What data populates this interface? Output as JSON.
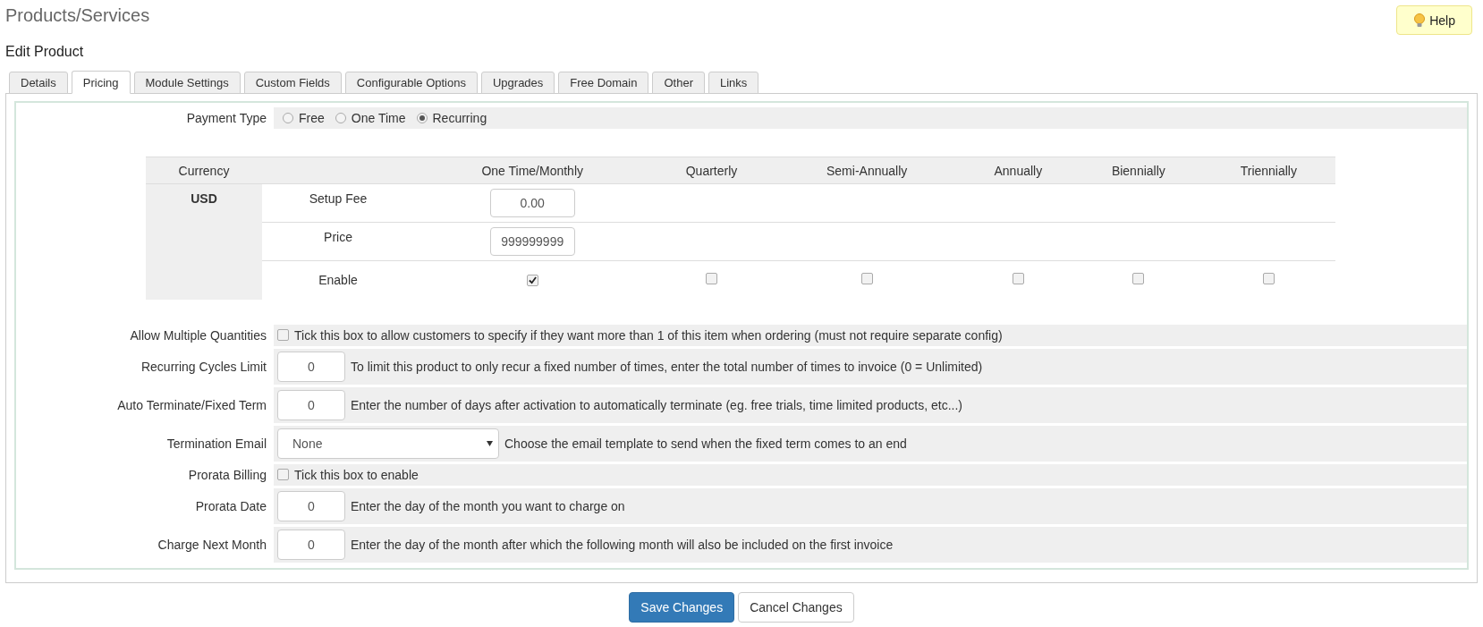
{
  "page_title": "Products/Services",
  "help_button": "Help",
  "section_title": "Edit Product",
  "tabs": [
    {
      "label": "Details",
      "selected": false
    },
    {
      "label": "Pricing",
      "selected": true
    },
    {
      "label": "Module Settings",
      "selected": false
    },
    {
      "label": "Custom Fields",
      "selected": false
    },
    {
      "label": "Configurable Options",
      "selected": false
    },
    {
      "label": "Upgrades",
      "selected": false
    },
    {
      "label": "Free Domain",
      "selected": false
    },
    {
      "label": "Other",
      "selected": false
    },
    {
      "label": "Links",
      "selected": false
    }
  ],
  "payment_type": {
    "label": "Payment Type",
    "options": [
      {
        "label": "Free",
        "selected": false
      },
      {
        "label": "One Time",
        "selected": false
      },
      {
        "label": "Recurring",
        "selected": true
      }
    ]
  },
  "pricing": {
    "currency_header": "Currency",
    "columns": [
      "One Time/Monthly",
      "Quarterly",
      "Semi-Annually",
      "Annually",
      "Biennially",
      "Triennially"
    ],
    "currency": "USD",
    "rows": [
      {
        "label": "Setup Fee",
        "value": "0.00"
      },
      {
        "label": "Price",
        "value": "999999999"
      }
    ],
    "enable": {
      "label": "Enable",
      "checks": [
        {
          "checked": true
        },
        {
          "checked": false
        },
        {
          "checked": false
        },
        {
          "checked": false
        },
        {
          "checked": false
        },
        {
          "checked": false
        }
      ]
    }
  },
  "settings": [
    {
      "kind": "checkbox",
      "label": "Allow Multiple Quantities",
      "checked": false,
      "text": "Tick this box to allow customers to specify if they want more than 1 of this item when ordering (must not require separate config)"
    },
    {
      "kind": "number",
      "label": "Recurring Cycles Limit",
      "value": "0",
      "text": "To limit this product to only recur a fixed number of times, enter the total number of times to invoice (0 = Unlimited)"
    },
    {
      "kind": "number",
      "label": "Auto Terminate/Fixed Term",
      "value": "0",
      "text": "Enter the number of days after activation to automatically terminate (eg. free trials, time limited products, etc...)"
    },
    {
      "kind": "select",
      "label": "Termination Email",
      "value": "None",
      "text": "Choose the email template to send when the fixed term comes to an end"
    },
    {
      "kind": "checkbox",
      "label": "Prorata Billing",
      "checked": false,
      "text": "Tick this box to enable"
    },
    {
      "kind": "number",
      "label": "Prorata Date",
      "value": "0",
      "text": "Enter the day of the month you want to charge on"
    },
    {
      "kind": "number",
      "label": "Charge Next Month",
      "value": "0",
      "text": "Enter the day of the month after which the following month will also be included on the first invoice"
    }
  ],
  "buttons": [
    {
      "label": "Save Changes",
      "kind": "primary"
    },
    {
      "label": "Cancel Changes",
      "kind": "default"
    }
  ]
}
